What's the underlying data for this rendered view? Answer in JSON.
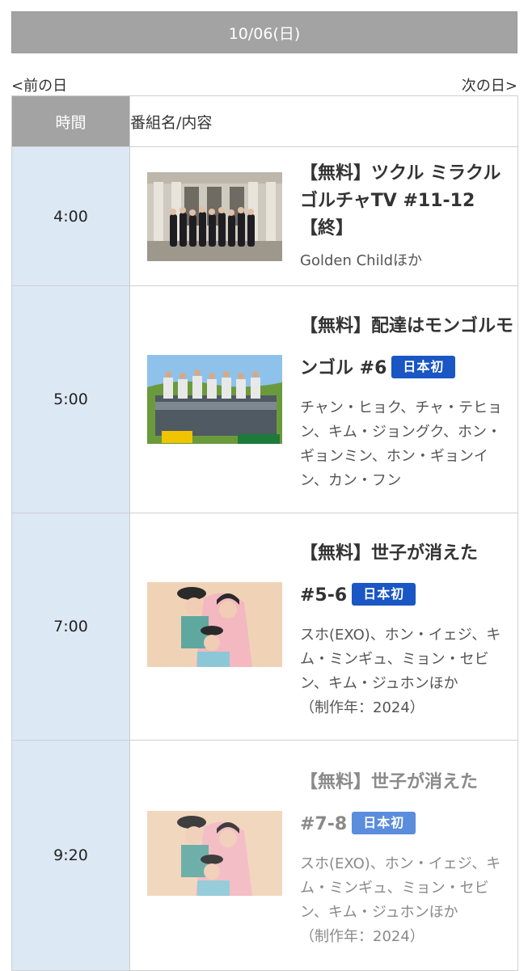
{
  "header": {
    "date": "10/06(日)"
  },
  "nav": {
    "prev": "<前の日",
    "next": "次の日>"
  },
  "table": {
    "col_time": "時間",
    "col_program": "番組名/内容",
    "rows": [
      {
        "time": "4:00",
        "title": "【無料】ツクル ミラクル ゴルチャTV #11-12【終】",
        "badge": "",
        "cast": "Golden Childほか"
      },
      {
        "time": "5:00",
        "title": "【無料】配達はモンゴルモンゴル #6",
        "badge": "日本初",
        "cast": "チャン・ヒョク、チャ・テヒョン、キム・ジョングク、ホン・ギョンミン、ホン・ギョンイン、カン・フン"
      },
      {
        "time": "7:00",
        "title": "【無料】世子が消えた #5-6",
        "badge": "日本初",
        "cast": "スホ(EXO)、ホン・イェジ、キム・ミンギュ、ミョン・セビン、キム・ジュホンほか",
        "year": "（制作年：2024）"
      },
      {
        "time": "9:20",
        "title": "【無料】世子が消えた #7-8",
        "badge": "日本初",
        "cast": "スホ(EXO)、ホン・イェジ、キム・ミンギュ、ミョン・セビン、キム・ジュホンほか",
        "year": "（制作年：2024）"
      }
    ]
  },
  "colors": {
    "header_bg": "#a3a3a3",
    "time_bg": "#dde8f5",
    "badge": "#1a56c4"
  }
}
